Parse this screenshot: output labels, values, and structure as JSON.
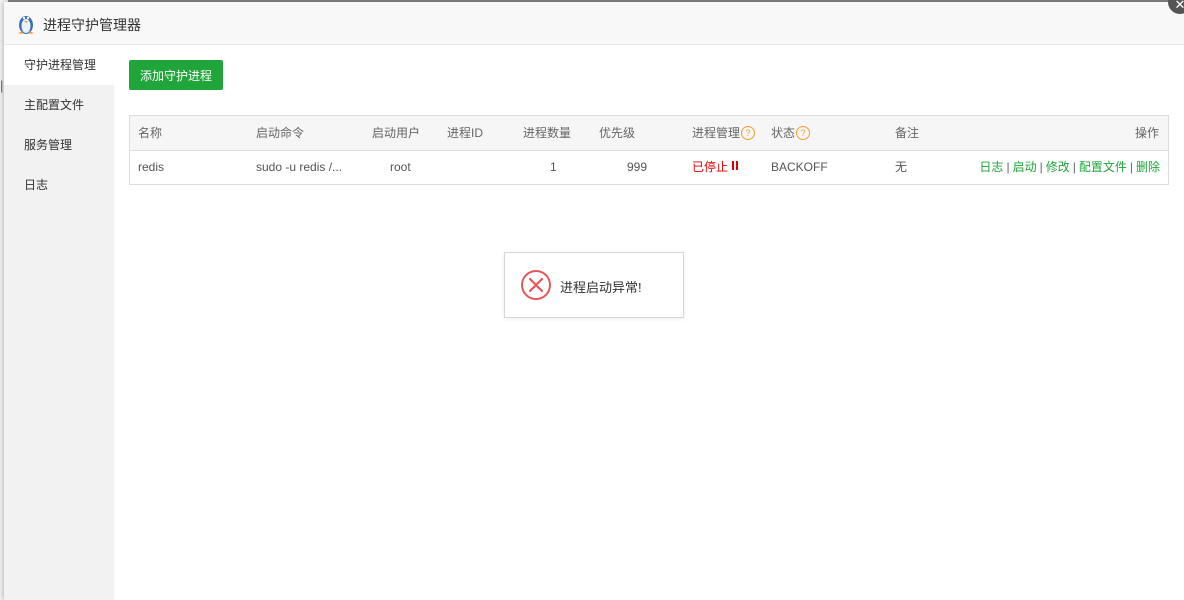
{
  "window": {
    "title": "进程守护管理器",
    "logo_icon": "linux-penguin-icon",
    "close_icon": "close-icon"
  },
  "sidebar": {
    "items": [
      {
        "label": "守护进程管理",
        "active": true
      },
      {
        "label": "主配置文件",
        "active": false
      },
      {
        "label": "服务管理",
        "active": false
      },
      {
        "label": "日志",
        "active": false
      }
    ]
  },
  "toolbar": {
    "add_label": "添加守护进程"
  },
  "table": {
    "headers": {
      "name": "名称",
      "command": "启动命令",
      "user": "启动用户",
      "pid": "进程ID",
      "count": "进程数量",
      "priority": "优先级",
      "manage": "进程管理",
      "status": "状态",
      "note": "备注",
      "actions": "操作"
    },
    "help_glyph": "?",
    "rows": [
      {
        "name": "redis",
        "command": "sudo -u redis /...",
        "user": "root",
        "pid": "",
        "count": "1",
        "priority": "999",
        "manage": "已停止",
        "status": "BACKOFF",
        "note": "无",
        "actions": [
          "日志",
          "启动",
          "修改",
          "配置文件",
          "删除"
        ]
      }
    ],
    "action_separator": "|"
  },
  "toast": {
    "message": "进程启动异常!",
    "icon": "error-circle-icon"
  },
  "colors": {
    "accent_green": "#20a53a",
    "error_red": "#e00000",
    "help_orange": "#f0a02f",
    "toast_icon_red": "#e8565a"
  }
}
